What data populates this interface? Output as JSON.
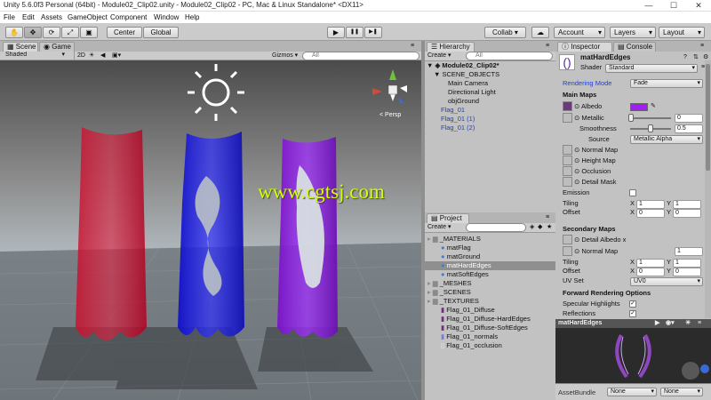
{
  "window": {
    "title": "Unity 5.6.0f3 Personal (64bit) - Module02_Clip02.unity - Module02_Clip02 - PC, Mac & Linux Standalone* <DX11>",
    "minimize": "—",
    "maximize": "☐",
    "close": "✕"
  },
  "menu": [
    "File",
    "Edit",
    "Assets",
    "GameObject",
    "Component",
    "Window",
    "Help"
  ],
  "toolbar": {
    "pivot": "Center",
    "space": "Global",
    "play": "▶",
    "pause": "❚❚",
    "step": "▶❚",
    "collab": "Collab ▾",
    "account": "Account",
    "layers": "Layers",
    "layout": "Layout"
  },
  "scene": {
    "tab_scene": "Scene",
    "tab_game": "Game",
    "shading": "Shaded",
    "mode_2d": "2D",
    "gizmos": "Gizmos ▾",
    "search_placeholder": "All",
    "persp": "< Persp",
    "watermark": "www.cgtsj.com"
  },
  "hierarchy": {
    "title": "Hierarchy",
    "create": "Create ▾",
    "search_placeholder": "All",
    "scene_name": "Module02_Clip02*",
    "items": [
      {
        "label": "SCENE_OBJECTS",
        "style": "normal"
      },
      {
        "label": "Main Camera",
        "style": "normal"
      },
      {
        "label": "Directional Light",
        "style": "normal"
      },
      {
        "label": "objGround",
        "style": "normal"
      },
      {
        "label": "Flag_01",
        "style": "blue"
      },
      {
        "label": "Flag_01 (1)",
        "style": "blue"
      },
      {
        "label": "Flag_01 (2)",
        "style": "blue"
      }
    ]
  },
  "project": {
    "title": "Project",
    "create": "Create ▾",
    "items": [
      {
        "label": "_MATERIALS",
        "kind": "folder",
        "selected": false
      },
      {
        "label": "matFlag",
        "kind": "material",
        "selected": false
      },
      {
        "label": "matGround",
        "kind": "material",
        "selected": false
      },
      {
        "label": "matHardEdges",
        "kind": "material",
        "selected": true
      },
      {
        "label": "matSoftEdges",
        "kind": "material",
        "selected": false
      },
      {
        "label": "_MESHES",
        "kind": "folder",
        "selected": false
      },
      {
        "label": "_SCENES",
        "kind": "folder",
        "selected": false
      },
      {
        "label": "_TEXTURES",
        "kind": "folder",
        "selected": false
      },
      {
        "label": "Flag_01_Diffuse",
        "kind": "texture",
        "selected": false
      },
      {
        "label": "Flag_01_Diffuse-HardEdges",
        "kind": "texture",
        "selected": false
      },
      {
        "label": "Flag_01_Diffuse-SoftEdges",
        "kind": "texture",
        "selected": false
      },
      {
        "label": "Flag_01_normals",
        "kind": "normal",
        "selected": false
      },
      {
        "label": "Flag_01_occlusion",
        "kind": "occlusion",
        "selected": false
      }
    ]
  },
  "inspector": {
    "tab_inspector": "Inspector",
    "tab_console": "Console",
    "material_name": "matHardEdges",
    "shader_label": "Shader",
    "shader_value": "Standard",
    "rendering_mode_label": "Rendering Mode",
    "rendering_mode_value": "Fade",
    "main_maps": "Main Maps",
    "albedo": "Albedo",
    "albedo_color": "#a020f0",
    "metallic": "Metallic",
    "metallic_value": "0",
    "smoothness": "Smoothness",
    "smoothness_value": "0.5",
    "source_label": "Source",
    "source_value": "Metallic Alpha",
    "normal_map": "Normal Map",
    "height_map": "Height Map",
    "occlusion": "Occlusion",
    "detail_mask": "Detail Mask",
    "emission": "Emission",
    "tiling": "Tiling",
    "offset": "Offset",
    "main_tiling": {
      "x": "1",
      "y": "1"
    },
    "main_offset": {
      "x": "0",
      "y": "0"
    },
    "secondary_maps": "Secondary Maps",
    "detail_albedo": "Detail Albedo x",
    "sec_normal_map": "Normal Map",
    "sec_normal_value": "1",
    "sec_tiling": {
      "x": "1",
      "y": "1"
    },
    "sec_offset": {
      "x": "0",
      "y": "0"
    },
    "uv_set_label": "UV Set",
    "uv_set_value": "UV0",
    "forward_options": "Forward Rendering Options",
    "specular_highlights": "Specular Highlights",
    "reflections": "Reflections",
    "axis_x": "X",
    "axis_y": "Y"
  },
  "preview": {
    "title": "matHardEdges",
    "asset_bundle_label": "AssetBundle",
    "asset_bundle_value": "None",
    "asset_bundle_variant": "None"
  }
}
